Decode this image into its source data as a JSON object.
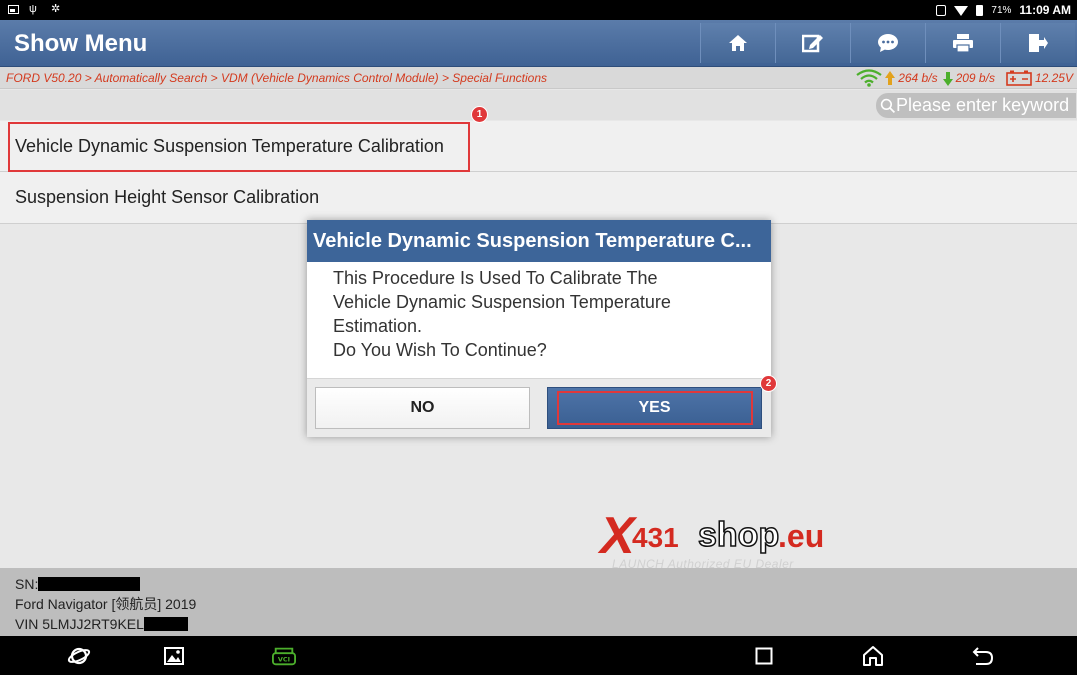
{
  "status_bar": {
    "battery_percent": "71%",
    "time": "11:09 AM"
  },
  "header": {
    "title": "Show Menu",
    "tools": [
      "home-icon",
      "edit-icon",
      "message-icon",
      "print-icon",
      "exit-icon"
    ]
  },
  "breadcrumb": "FORD V50.20 > Automatically Search > VDM (Vehicle Dynamics Control Module) > Special Functions",
  "network": {
    "upload": "264 b/s",
    "download": "209 b/s",
    "voltage": "12.25V"
  },
  "search": {
    "placeholder": "Please enter keyword"
  },
  "menu_items": [
    {
      "label": "Vehicle Dynamic Suspension Temperature Calibration"
    },
    {
      "label": "Suspension Height Sensor Calibration"
    }
  ],
  "annotations": {
    "badge1": "1",
    "badge2": "2"
  },
  "dialog": {
    "title": "Vehicle Dynamic Suspension Temperature C...",
    "body_lines": [
      "This Procedure Is Used To Calibrate The",
      "Vehicle Dynamic Suspension Temperature",
      "Estimation.",
      "Do You Wish To Continue?"
    ],
    "no_label": "NO",
    "yes_label": "YES"
  },
  "vehicle_info": {
    "sn_label": "SN:",
    "model": "Ford Navigator [领航员] 2019",
    "vin_label": "VIN 5LMJJ2RT9KEL"
  },
  "watermark": {
    "x": "X",
    "num": "431",
    "shop": "shop",
    "tld": ".eu",
    "sub": "LAUNCH Authorized EU Dealer"
  },
  "colors": {
    "header_blue": "#3f6294",
    "accent_red": "#e0383a",
    "crumb_red": "#d43a1e"
  }
}
